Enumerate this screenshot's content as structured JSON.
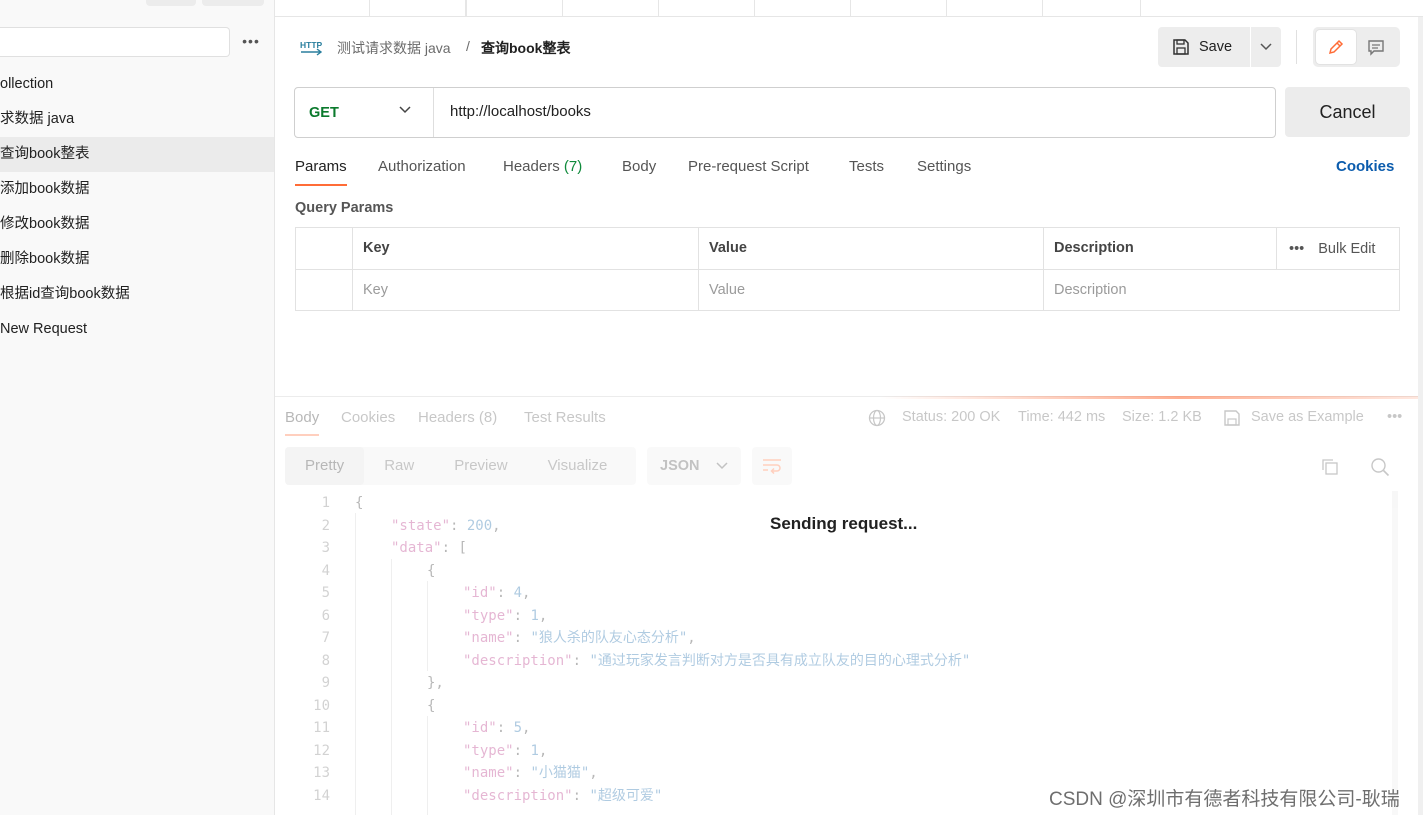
{
  "sidebar": {
    "items": [
      {
        "label": "ollection",
        "active": false
      },
      {
        "label": "求数据 java",
        "active": false
      },
      {
        "label": "查询book整表",
        "active": true
      },
      {
        "label": "添加book数据",
        "active": false
      },
      {
        "label": "修改book数据",
        "active": false
      },
      {
        "label": "删除book数据",
        "active": false
      },
      {
        "label": "根据id查询book数据",
        "active": false
      },
      {
        "label": "New Request",
        "active": false
      }
    ],
    "more_label": "•••"
  },
  "breadcrumb": {
    "icon_label": "HTTP",
    "parent": "测试请求数据 java",
    "separator": "/",
    "current": "查询book整表"
  },
  "toolbar": {
    "save_label": "Save"
  },
  "request": {
    "method": "GET",
    "url": "http://localhost/books",
    "cancel_label": "Cancel"
  },
  "request_tabs": {
    "params": "Params",
    "authorization": "Authorization",
    "headers": "Headers",
    "headers_count": "(7)",
    "body": "Body",
    "prerequest": "Pre-request Script",
    "tests": "Tests",
    "settings": "Settings",
    "cookies": "Cookies"
  },
  "query_params": {
    "title": "Query Params",
    "columns": {
      "key": "Key",
      "value": "Value",
      "description": "Description"
    },
    "placeholders": {
      "key": "Key",
      "value": "Value",
      "description": "Description"
    },
    "bulk_more": "•••",
    "bulk_edit": "Bulk Edit"
  },
  "response": {
    "tabs": {
      "body": "Body",
      "cookies": "Cookies",
      "headers": "Headers (8)",
      "tests": "Test Results"
    },
    "status": "Status: 200 OK",
    "time": "Time: 442 ms",
    "size": "Size: 1.2 KB",
    "save_example": "Save as Example",
    "more": "•••",
    "formats": [
      "Pretty",
      "Raw",
      "Preview",
      "Visualize"
    ],
    "language": "JSON",
    "code": {
      "l1": "{",
      "l2_key": "\"state\"",
      "l2_val": "200",
      "l3_key": "\"data\"",
      "l3_tail": "[",
      "l4": "{",
      "l5_key": "\"id\"",
      "l5_val": "4",
      "l6_key": "\"type\"",
      "l6_val": "1",
      "l7_key": "\"name\"",
      "l7_val": "\"狼人杀的队友心态分析\"",
      "l8_key": "\"description\"",
      "l8_val": "\"通过玩家发言判断对方是否具有成立队友的目的心理式分析\"",
      "l9": "},",
      "l10": "{",
      "l11_key": "\"id\"",
      "l11_val": "5",
      "l12_key": "\"type\"",
      "l12_val": "1",
      "l13_key": "\"name\"",
      "l13_val": "\"小猫猫\"",
      "l14_key": "\"description\"",
      "l14_val": "\"超级可爱\""
    }
  },
  "overlay": {
    "sending": "Sending request..."
  },
  "watermark": "CSDN @深圳市有德者科技有限公司-耿瑞"
}
